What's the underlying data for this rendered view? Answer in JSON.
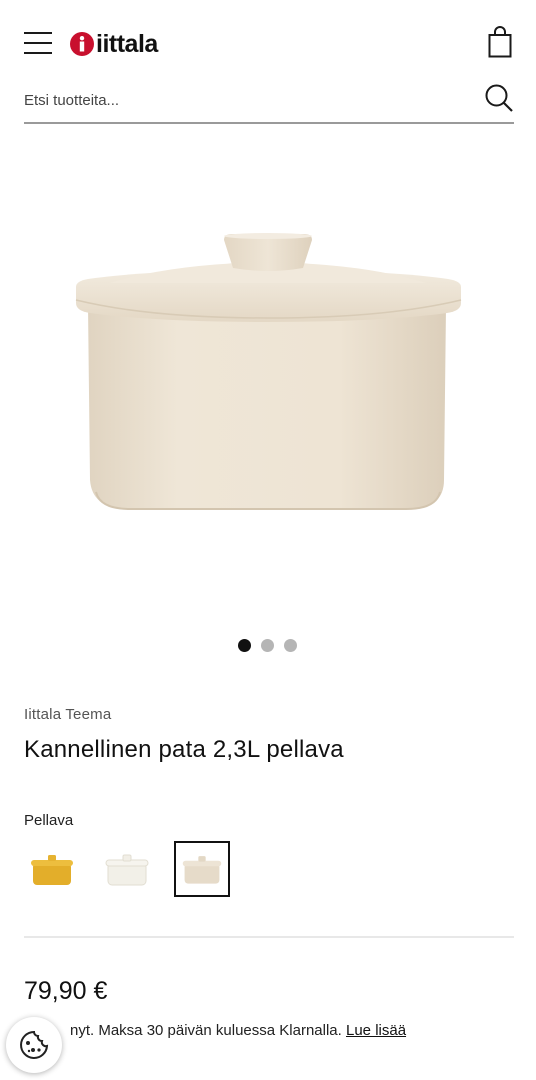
{
  "header": {
    "logo_text": "iittala",
    "menu_icon": "hamburger-menu-icon",
    "cart_icon": "shopping-bag-icon"
  },
  "search": {
    "placeholder": "Etsi tuotteita...",
    "icon": "search-icon"
  },
  "gallery": {
    "image_alt": "Kannellinen pata 2,3L pellava",
    "slide_count": 3,
    "active_index": 0
  },
  "product": {
    "brand": "Iittala Teema",
    "title": "Kannellinen pata 2,3L pellava",
    "color_label": "Pellava",
    "swatches": [
      {
        "name": "hunaja",
        "color": "#E9B833",
        "selected": false
      },
      {
        "name": "valkoinen",
        "color": "#F3F1EA",
        "selected": false
      },
      {
        "name": "pellava",
        "color": "#E7DCCB",
        "selected": true
      }
    ],
    "price": "79,90 €",
    "klarna_text": "nyt. Maksa 30 päivän kuluessa Klarnalla.",
    "klarna_link": "Lue lisää"
  },
  "colors": {
    "pot_body": "#EDE3D3",
    "logo_red": "#C8102E"
  },
  "cookie": {
    "icon": "cookie-icon"
  }
}
